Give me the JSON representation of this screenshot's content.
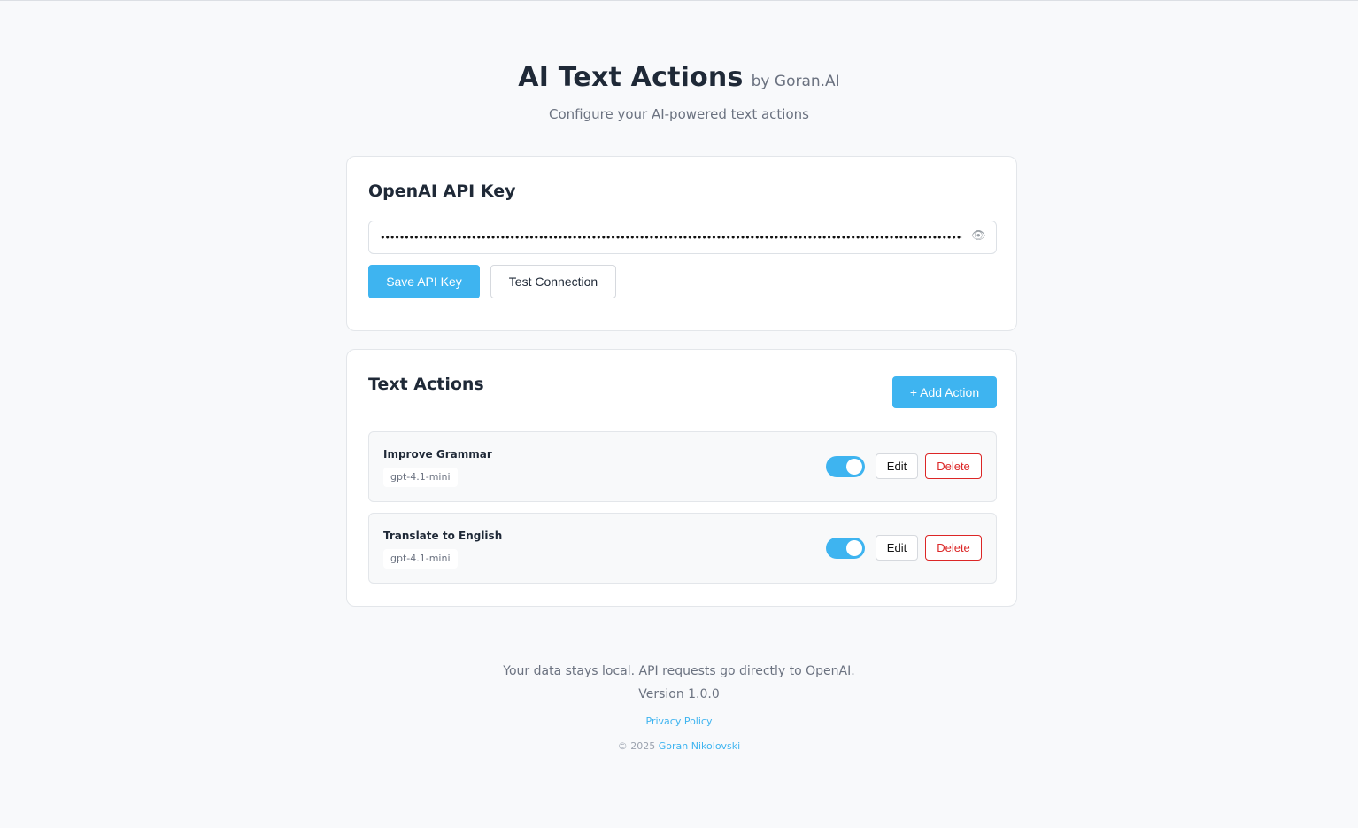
{
  "header": {
    "title": "AI Text Actions",
    "byline": "by Goran.AI",
    "subtitle": "Configure your AI-powered text actions"
  },
  "api_card": {
    "title": "OpenAI API Key",
    "key_value": "••••••••••••••••••••••••••••••••••••••••••••••••••••••••••••••••••••••••••••••••••••••••••••••••••••••••••••••••••••••••••••••••••••••••••••",
    "eye_icon": "👁",
    "save_label": "Save API Key",
    "test_label": "Test Connection"
  },
  "actions_card": {
    "title": "Text Actions",
    "add_label": "+ Add Action",
    "items": [
      {
        "name": "Improve Grammar",
        "model": "gpt-4.1-mini",
        "enabled": true,
        "edit_label": "Edit",
        "delete_label": "Delete"
      },
      {
        "name": "Translate to English",
        "model": "gpt-4.1-mini",
        "enabled": true,
        "edit_label": "Edit",
        "delete_label": "Delete"
      }
    ]
  },
  "footer": {
    "note": "Your data stays local. API requests go directly to OpenAI.",
    "version": "Version 1.0.0",
    "privacy_link": "Privacy Policy",
    "copyright_prefix": "© 2025",
    "author_link": "Goran Nikolovski"
  },
  "colors": {
    "accent": "#3eb4f0",
    "danger": "#dc2626",
    "background": "#f8f9fb"
  }
}
